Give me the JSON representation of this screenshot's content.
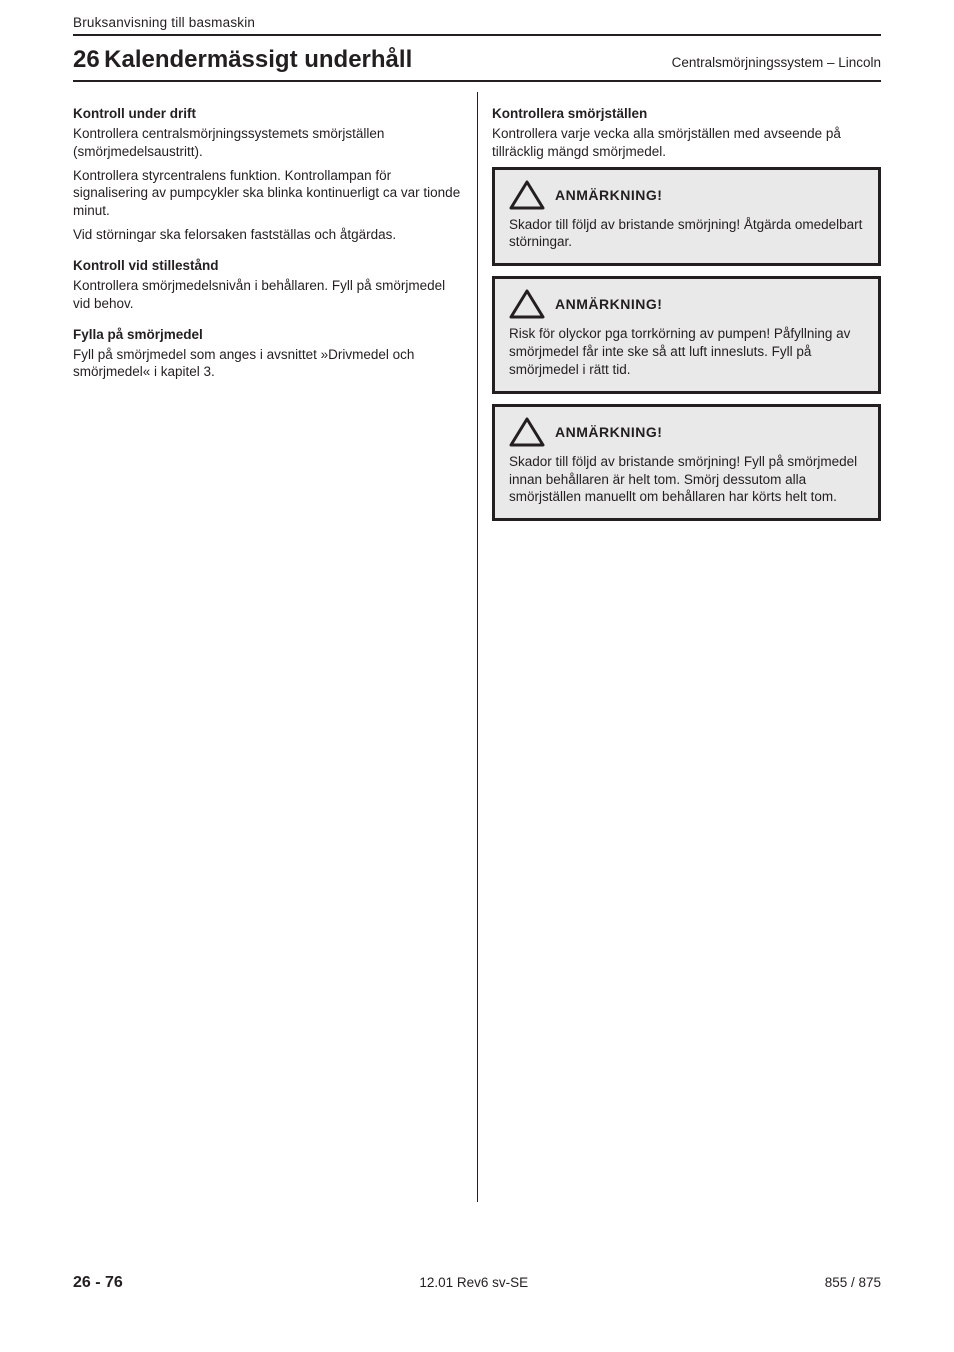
{
  "header": {
    "top_title": "Bruksanvisning till basmaskin",
    "section_number": "26",
    "section_title": "Kalendermässigt underhåll",
    "section_subtitle": "Centralsmörjningssystem – Lincoln"
  },
  "left": {
    "h1": "Kontroll under drift",
    "p1": "Kontrollera centralsmörjningssystemets smörjställen (smörjmedelsaustritt).",
    "p2": "Kontrollera styrcentralens funktion. Kontrollampan för signalisering av pumpcykler ska blinka kontinuerligt ca var tionde minut.",
    "p3": "Vid störningar ska felorsaken fastställas och åtgärdas.",
    "h2": "Kontroll vid stillestånd",
    "p4": "Kontrollera smörjmedelsnivån i behållaren. Fyll på smörjmedel vid behov.",
    "h3": "Fylla på smörjmedel",
    "p5": "Fyll på smörjmedel som anges i avsnittet »Drivmedel och smörjmedel« i kapitel 3."
  },
  "right": {
    "intro_h": "Kontrollera smörjställen",
    "intro_p": "Kontrollera varje vecka alla smörjställen med avseende på tillräcklig mängd smörjmedel.",
    "box1": {
      "label": "ANMÄRKNING!",
      "p": "Skador till följd av bristande smörjning! Åtgärda omedelbart störningar."
    },
    "box2": {
      "label": "ANMÄRKNING!",
      "p": "Risk för olyckor pga torrkörning av pumpen! Påfyllning av smörjmedel får inte ske så att luft innesluts. Fyll på smörjmedel i rätt tid."
    },
    "box3": {
      "label": "ANMÄRKNING!",
      "p": "Skador till följd av bristande smörjning! Fyll på smörjmedel innan behållaren är helt tom. Smörj dessutom alla smörjställen manuellt om behållaren har körts helt tom."
    }
  },
  "footer": {
    "page": "26 - 76",
    "note": "12.01 Rev6   sv-SE",
    "code": "855 / 875"
  }
}
